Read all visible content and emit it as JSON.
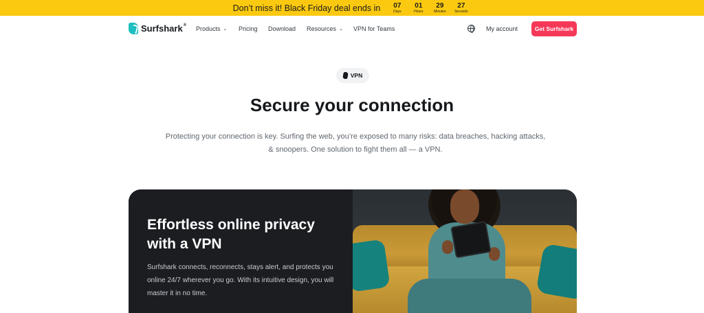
{
  "promo": {
    "text": "Don’t miss it! Black Friday deal ends in",
    "timer": [
      {
        "value": "07",
        "unit": "Days"
      },
      {
        "value": "01",
        "unit": "Hours"
      },
      {
        "value": "29",
        "unit": "Minutes"
      },
      {
        "value": "27",
        "unit": "Seconds"
      }
    ],
    "background_color": "#fbc910"
  },
  "nav": {
    "logo_text": "Surfshark",
    "logo_reg": "®",
    "items": [
      {
        "label": "Products",
        "dropdown": true
      },
      {
        "label": "Pricing",
        "dropdown": false
      },
      {
        "label": "Download",
        "dropdown": false
      },
      {
        "label": "Resources",
        "dropdown": true
      },
      {
        "label": "VPN for Teams",
        "dropdown": false
      }
    ],
    "language_icon": "globe-icon",
    "account_label": "My account",
    "cta_label": "Get Surfshark",
    "cta_color": "#f63858",
    "brand_color": "#1ebfbf"
  },
  "hero": {
    "badge": "VPN",
    "title": "Secure your connection",
    "subtitle": "Protecting your connection is key. Surfing the web, you’re exposed to many risks: data breaches, hacking attacks, & snoopers. One solution to fight them all — a VPN."
  },
  "card": {
    "title": "Effortless online privacy with a VPN",
    "text": "Surfshark connects, reconnects, stays alert, and protects you online 24/7 wherever you go. With its intuitive design, you will master it in no time."
  }
}
